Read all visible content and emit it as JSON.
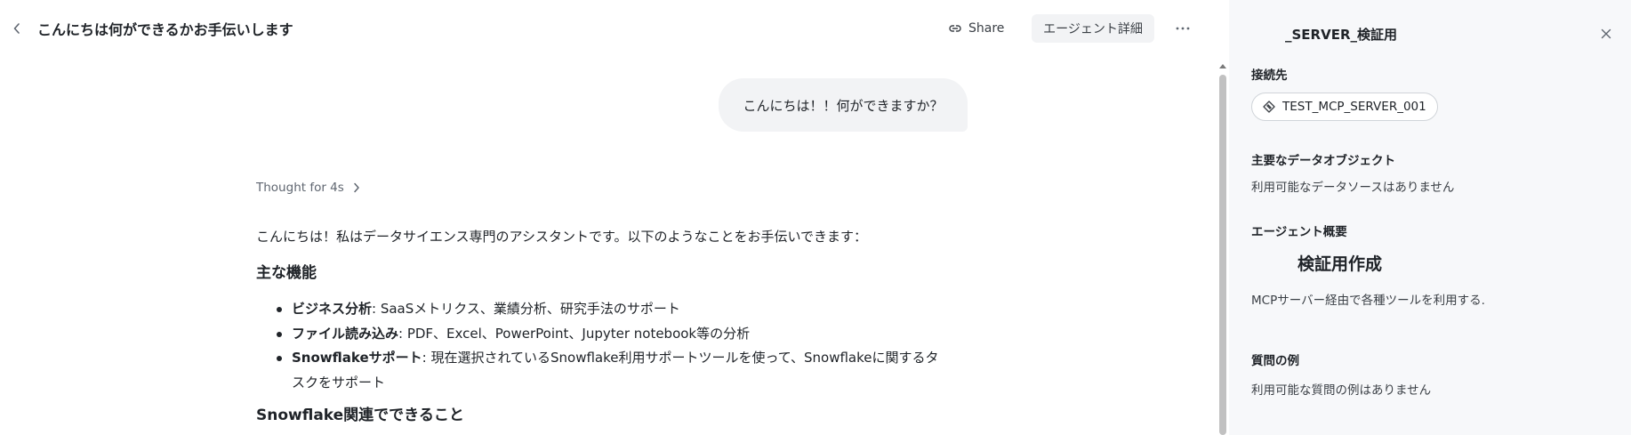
{
  "header": {
    "title": "こんにちは何ができるかお手伝いします",
    "back_icon": "chevron-left-icon",
    "share_label": "Share",
    "share_icon": "link-icon",
    "agent_details_label": "エージェント詳細",
    "more_icon": "ellipsis-icon"
  },
  "chat": {
    "user_message": "こんにちは！！何ができますか？",
    "thought_label": "Thought for 4s",
    "assistant": {
      "intro": "こんにちは！私はデータサイエンス専門のアシスタントです。以下のようなことをお手伝いできます：",
      "heading_main": "主な機能",
      "features": [
        {
          "title": "ビジネス分析",
          "text": ": SaaSメトリクス、業績分析、研究手法のサポート"
        },
        {
          "title": "ファイル読み込み",
          "text": ": PDF、Excel、PowerPoint、Jupyter notebook等の分析"
        },
        {
          "title": "Snowflakeサポート",
          "text": ": 現在選択されているSnowflake利用サポートツールを使って、Snowflakeに関するタ",
          "text2": "スクをサポート"
        }
      ],
      "heading_snowflake": "Snowflake関連でできること"
    }
  },
  "panel": {
    "title": "_SERVER_検証用",
    "close_icon": "close-icon",
    "connection_label": "接続先",
    "connection_value": "TEST_MCP_SERVER_001",
    "connection_icon": "server-diamond-icon",
    "data_objects_label": "主要なデータオブジェクト",
    "data_objects_value": "利用可能なデータソースはありません",
    "overview_label": "エージェント概要",
    "overview_title": "検証用作成",
    "overview_desc": "MCPサーバー経由で各種ツールを利用する.",
    "examples_label": "質問の例",
    "examples_value": "利用可能な質問の例はありません"
  },
  "colors": {
    "panel_bg": "#f7f8fa",
    "bubble_bg": "#f2f3f5",
    "text": "#1f2328",
    "muted": "#5f6670"
  }
}
